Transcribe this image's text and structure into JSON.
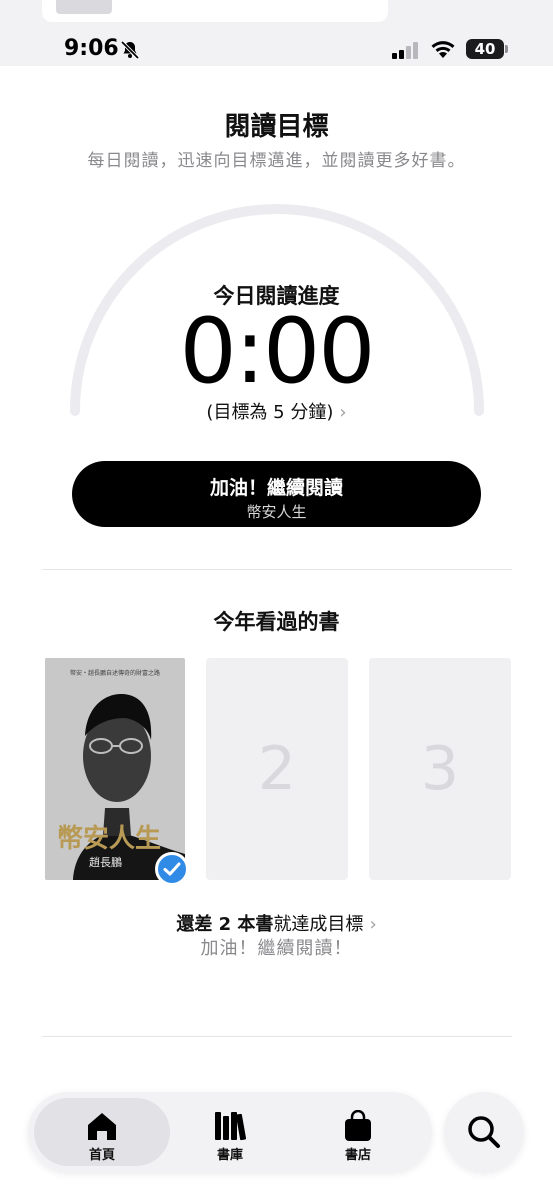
{
  "status_bar": {
    "time": "9:06",
    "battery": "40",
    "icons": [
      "bell-slash-icon",
      "cellular-signal-icon",
      "wifi-icon",
      "battery-icon"
    ]
  },
  "reading_goal": {
    "title": "閱讀目標",
    "subtitle": "每日閱讀，迅速向目標邁進，並閱讀更多好書。",
    "today_label": "今日閱讀進度",
    "timer": "0:00",
    "progress_fraction": 0,
    "target_text": "(目標為 5 分鐘)",
    "cta_label": "加油！繼續閱讀",
    "cta_book": "幣安人生"
  },
  "books_this_year": {
    "title": "今年看過的書",
    "books": [
      {
        "title": "幣安人生",
        "author": "趙長鵬",
        "tagline": "幣安・趙長鵬自述傳奇的財富之路",
        "completed": true
      }
    ],
    "placeholders": [
      "2",
      "3"
    ],
    "remaining_prefix": "還差 ",
    "remaining_count": "2",
    "remaining_unit": " 本書",
    "remaining_suffix": "就達成目標",
    "encouragement": "加油！繼續閱讀！"
  },
  "tab_bar": {
    "tabs": [
      {
        "label": "首頁",
        "icon": "home-icon",
        "active": true
      },
      {
        "label": "書庫",
        "icon": "library-icon",
        "active": false
      },
      {
        "label": "書店",
        "icon": "bookstore-bag-icon",
        "active": false
      }
    ],
    "search_icon": "search-icon"
  },
  "colors": {
    "accent_check": "#2f8be6",
    "cta_bg": "#000000",
    "arc_track": "#ececf0"
  }
}
